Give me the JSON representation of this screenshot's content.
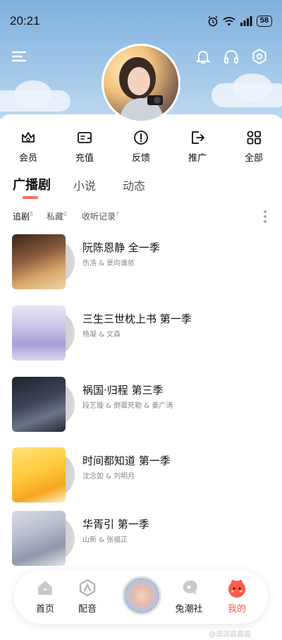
{
  "status_bar": {
    "time": "20:21",
    "battery": "58"
  },
  "header": {
    "icons": [
      "menu-icon",
      "bell-icon",
      "headphones-icon",
      "settings-icon"
    ]
  },
  "quick_actions": [
    {
      "label": "会员",
      "icon": "crown-icon"
    },
    {
      "label": "充值",
      "icon": "wallet-icon"
    },
    {
      "label": "反馈",
      "icon": "alert-icon"
    },
    {
      "label": "推广",
      "icon": "share-icon"
    },
    {
      "label": "全部",
      "icon": "grid-icon"
    }
  ],
  "tabs": [
    {
      "label": "广播剧"
    },
    {
      "label": "小说"
    },
    {
      "label": "动态"
    }
  ],
  "subtabs": [
    {
      "label": "追剧",
      "count": "5"
    },
    {
      "label": "私藏",
      "count": "0"
    },
    {
      "label": "收听记录",
      "count": "7"
    }
  ],
  "list": [
    {
      "title": "阮陈恩静 全一季",
      "cast": "伤洛 & 景向谁依"
    },
    {
      "title": "三生三世枕上书 第一季",
      "cast": "杨凝 & 文森"
    },
    {
      "title": "祸国·归程 第三季",
      "cast": "段艺璇 & 倒霉死勒 & 姜广涛"
    },
    {
      "title": "时间都知道 第一季",
      "cast": "沈念如 & 刘明月"
    },
    {
      "title": "华胥引 第一季",
      "cast": "山新 & 张福正"
    }
  ],
  "bottom_nav": [
    {
      "label": "首页"
    },
    {
      "label": "配音"
    },
    {
      "label": "兔潮社"
    },
    {
      "label": "我的"
    }
  ],
  "watermark": "@逗逗酱酱酱",
  "colors": {
    "accent": "#ff6b5d",
    "sky": "#8fbbe2"
  }
}
